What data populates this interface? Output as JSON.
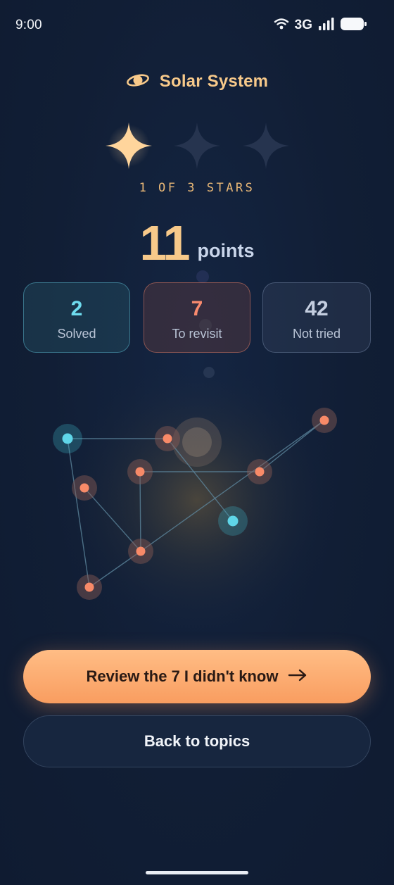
{
  "status_bar": {
    "time": "9:00",
    "network": "3G",
    "icons": [
      "wifi-icon",
      "signal-icon",
      "battery-icon"
    ]
  },
  "header": {
    "icon": "planet-icon",
    "title": "Solar System"
  },
  "stars": {
    "earned": 1,
    "total": 3,
    "caption": "1 OF 3 STARS",
    "earned_color": "#ffd59c",
    "empty_color": "#26344f"
  },
  "score": {
    "value": "11",
    "unit": "points"
  },
  "stats": [
    {
      "key": "solved",
      "value": "2",
      "label": "Solved",
      "color": "#6fdcef"
    },
    {
      "key": "revisit",
      "value": "7",
      "label": "To revisit",
      "color": "#f98a6e"
    },
    {
      "key": "nottried",
      "value": "42",
      "label": "Not tried",
      "color": "#c4cee0"
    }
  ],
  "colors": {
    "accent": "#f7c98a",
    "solved_node": "#5fd6e8",
    "revisit_node": "#f88a68",
    "background": "#101d33"
  },
  "buttons": {
    "primary_label": "Review the 7 I didn't know",
    "primary_icon": "arrow-right-icon",
    "secondary_label": "Back to topics"
  }
}
